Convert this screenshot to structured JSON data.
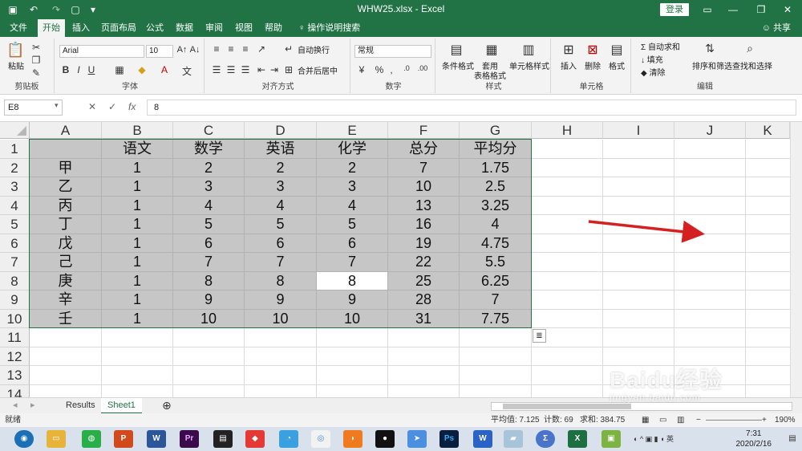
{
  "titlebar": {
    "filename": "WHW25.xlsx",
    "separator": " - ",
    "app": "Excel",
    "login": "登录",
    "controls": [
      "▭",
      "—",
      "❐",
      "✕"
    ]
  },
  "ribbon_tabs": [
    "文件",
    "开始",
    "插入",
    "页面布局",
    "公式",
    "数据",
    "审阅",
    "视图",
    "帮助"
  ],
  "active_tab": "开始",
  "tell_me": "操作说明搜索",
  "share": "共享",
  "ribbon": {
    "clipboard": {
      "label": "剪贴板",
      "paste": "粘贴"
    },
    "font": {
      "label": "字体",
      "family": "Arial",
      "size": "10",
      "bold": "B",
      "italic": "I",
      "underline": "U"
    },
    "alignment": {
      "label": "对齐方式",
      "wrap": "自动换行",
      "merge": "合并后居中"
    },
    "number": {
      "label": "数字",
      "format": "常规",
      "percent": "%",
      "comma": ","
    },
    "styles": {
      "label": "样式",
      "conditional": "条件格式",
      "table": "套用\n表格格式",
      "cell": "单元格样式"
    },
    "cells": {
      "label": "单元格",
      "insert": "插入",
      "delete": "删除",
      "format": "格式"
    },
    "editing": {
      "label": "编辑",
      "autosum": "自动求和",
      "fill": "填充",
      "clear": "清除",
      "sort": "排序和筛选",
      "find": "查找和选择"
    }
  },
  "formula_bar": {
    "name_box": "E8",
    "fx": "fx",
    "value": "8"
  },
  "columns": [
    "A",
    "B",
    "C",
    "D",
    "E",
    "F",
    "G",
    "H",
    "I",
    "J",
    "K"
  ],
  "rows": [
    "1",
    "2",
    "3",
    "4",
    "5",
    "6",
    "7",
    "8",
    "9",
    "10",
    "11",
    "12",
    "13",
    "14"
  ],
  "table": [
    [
      "",
      "语文",
      "数学",
      "英语",
      "化学",
      "总分",
      "平均分"
    ],
    [
      "甲",
      "1",
      "2",
      "2",
      "2",
      "7",
      "1.75"
    ],
    [
      "乙",
      "1",
      "3",
      "3",
      "3",
      "10",
      "2.5"
    ],
    [
      "丙",
      "1",
      "4",
      "4",
      "4",
      "13",
      "3.25"
    ],
    [
      "丁",
      "1",
      "5",
      "5",
      "5",
      "16",
      "4"
    ],
    [
      "戊",
      "1",
      "6",
      "6",
      "6",
      "19",
      "4.75"
    ],
    [
      "己",
      "1",
      "7",
      "7",
      "7",
      "22",
      "5.5"
    ],
    [
      "庚",
      "1",
      "8",
      "8",
      "8",
      "25",
      "6.25"
    ],
    [
      "辛",
      "1",
      "9",
      "9",
      "9",
      "28",
      "7"
    ],
    [
      "壬",
      "1",
      "10",
      "10",
      "10",
      "31",
      "7.75"
    ]
  ],
  "active_cell": "E8",
  "sheets": [
    "Results",
    "Sheet1"
  ],
  "active_sheet": "Sheet1",
  "status": {
    "mode": "就绪",
    "average": "平均值: 7.125",
    "count": "计数: 69",
    "sum": "求和: 384.75",
    "zoom": "190%"
  },
  "clock": {
    "time": "7:31",
    "date": "2020/2/16"
  },
  "watermark": {
    "brand": "Baidu经验",
    "url": "jingyan.baidu.com"
  },
  "accent_color": "#217346",
  "annotation_color": "#d42020"
}
